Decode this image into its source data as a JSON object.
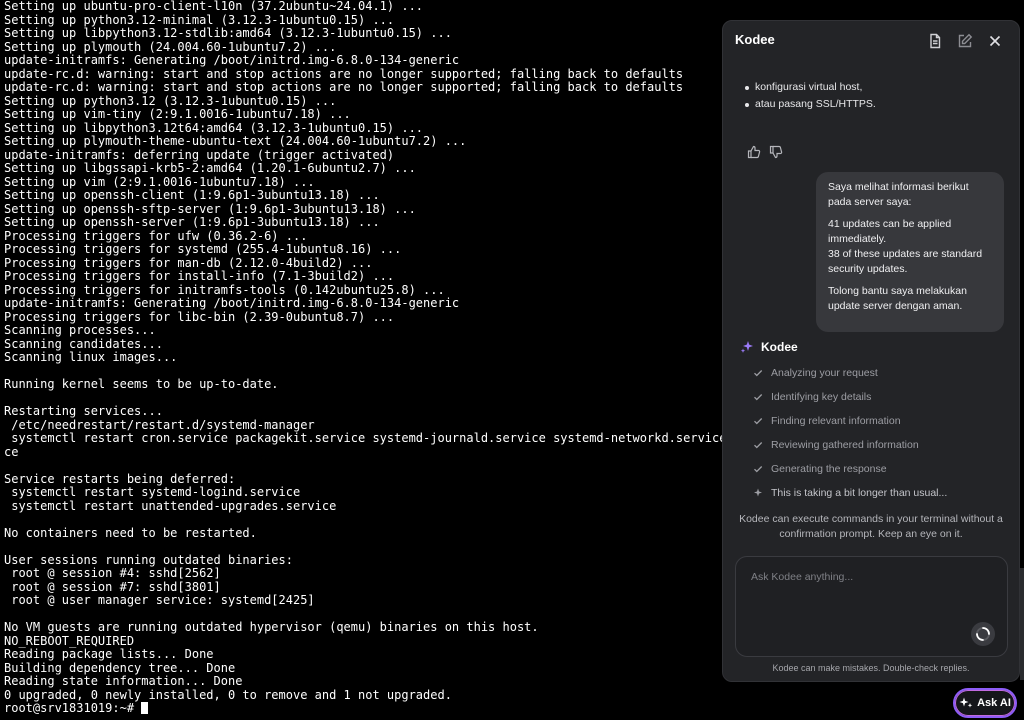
{
  "terminal": {
    "lines": [
      "Setting up ubuntu-pro-client-l10n (37.2ubuntu~24.04.1) ...",
      "Setting up python3.12-minimal (3.12.3-1ubuntu0.15) ...",
      "Setting up libpython3.12-stdlib:amd64 (3.12.3-1ubuntu0.15) ...",
      "Setting up plymouth (24.004.60-1ubuntu7.2) ...",
      "update-initramfs: Generating /boot/initrd.img-6.8.0-134-generic",
      "update-rc.d: warning: start and stop actions are no longer supported; falling back to defaults",
      "update-rc.d: warning: start and stop actions are no longer supported; falling back to defaults",
      "Setting up python3.12 (3.12.3-1ubuntu0.15) ...",
      "Setting up vim-tiny (2:9.1.0016-1ubuntu7.18) ...",
      "Setting up libpython3.12t64:amd64 (3.12.3-1ubuntu0.15) ...",
      "Setting up plymouth-theme-ubuntu-text (24.004.60-1ubuntu7.2) ...",
      "update-initramfs: deferring update (trigger activated)",
      "Setting up libgssapi-krb5-2:amd64 (1.20.1-6ubuntu2.7) ...",
      "Setting up vim (2:9.1.0016-1ubuntu7.18) ...",
      "Setting up openssh-client (1:9.6p1-3ubuntu13.18) ...",
      "Setting up openssh-sftp-server (1:9.6p1-3ubuntu13.18) ...",
      "Setting up openssh-server (1:9.6p1-3ubuntu13.18) ...",
      "Processing triggers for ufw (0.36.2-6) ...",
      "Processing triggers for systemd (255.4-1ubuntu8.16) ...",
      "Processing triggers for man-db (2.12.0-4build2) ...",
      "Processing triggers for install-info (7.1-3build2) ...",
      "Processing triggers for initramfs-tools (0.142ubuntu25.8) ...",
      "update-initramfs: Generating /boot/initrd.img-6.8.0-134-generic",
      "Processing triggers for libc-bin (2.39-0ubuntu8.7) ...",
      "Scanning processes...",
      "Scanning candidates...",
      "Scanning linux images...",
      "",
      "Running kernel seems to be up-to-date.",
      "",
      "Restarting services...",
      " /etc/needrestart/restart.d/systemd-manager",
      " systemctl restart cron.service packagekit.service systemd-journald.service systemd-networkd.service syste",
      "ce",
      "",
      "Service restarts being deferred:",
      " systemctl restart systemd-logind.service",
      " systemctl restart unattended-upgrades.service",
      "",
      "No containers need to be restarted.",
      "",
      "User sessions running outdated binaries:",
      " root @ session #4: sshd[2562]",
      " root @ session #7: sshd[3801]",
      " root @ user manager service: systemd[2425]",
      "",
      "No VM guests are running outdated hypervisor (qemu) binaries on this host.",
      "NO_REBOOT_REQUIRED",
      "Reading package lists... Done",
      "Building dependency tree... Done",
      "Reading state information... Done",
      "0 upgraded, 0 newly installed, 0 to remove and 1 not upgraded."
    ],
    "prompt": "root@srv1831019:~# "
  },
  "kodee": {
    "title": "Kodee",
    "header_icons": [
      "document-icon",
      "edit-icon",
      "close-icon"
    ],
    "bullets": [
      "konfigurasi virtual host,",
      "atau pasang SSL/HTTPS."
    ],
    "user_message": {
      "p1": "Saya melihat informasi berikut pada server saya:",
      "p2a": "41 updates can be applied immediately.",
      "p2b": "38 of these updates are standard security updates.",
      "p3": "Tolong bantu saya melakukan update server dengan aman."
    },
    "assistant_name": "Kodee",
    "steps": [
      {
        "label": "Analyzing your request",
        "status": "done"
      },
      {
        "label": "Identifying key details",
        "status": "done"
      },
      {
        "label": "Finding relevant information",
        "status": "done"
      },
      {
        "label": "Reviewing gathered information",
        "status": "done"
      },
      {
        "label": "Generating the response",
        "status": "done"
      },
      {
        "label": "This is taking a bit longer than usual...",
        "status": "pending"
      }
    ],
    "disclaimer": "Kodee can execute commands in your terminal without a confirmation prompt. Keep an eye on it.",
    "input_placeholder": "Ask Kodee anything...",
    "input_value": "",
    "footnote": "Kodee can make mistakes. Double-check replies."
  },
  "ask_ai": {
    "label": "Ask AI"
  },
  "colors": {
    "terminal_bg": "#000000",
    "panel_bg": "#232427",
    "bubble_bg": "#37383c",
    "accent": "#8d5cf6"
  }
}
